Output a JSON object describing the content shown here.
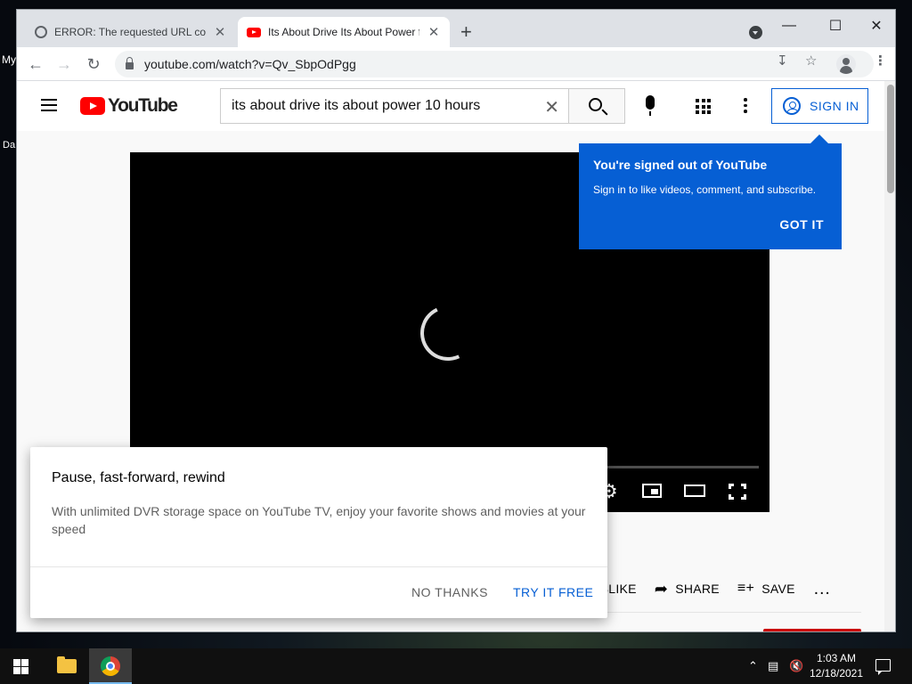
{
  "desktop": {
    "label1": "My",
    "label2": "Da"
  },
  "browser": {
    "tabs": [
      {
        "title": "ERROR: The requested URL could",
        "favicon": "globe-icon",
        "active": false
      },
      {
        "title": "Its About Drive Its About Power f",
        "favicon": "youtube-favicon",
        "active": true
      }
    ],
    "url": "youtube.com/watch?v=Qv_SbpOdPgg"
  },
  "youtube": {
    "logo_text": "YouTube",
    "search_value": "its about drive its about power 10 hours",
    "sign_in_label": "SIGN IN",
    "tooltip": {
      "title": "You're signed out of YouTube",
      "body": "Sign in to like videos, comment, and subscribe.",
      "button": "GOT IT"
    },
    "actions": {
      "dislike": "DISLIKE",
      "share": "SHARE",
      "save": "SAVE"
    },
    "promo": {
      "title": "Pause, fast-forward, rewind",
      "body": "With unlimited DVR storage space on YouTube TV, enjoy your favorite shows and movies at your speed",
      "no_thanks": "NO THANKS",
      "try_free": "TRY IT FREE"
    }
  },
  "taskbar": {
    "time": "1:03 AM",
    "date": "12/18/2021"
  },
  "colors": {
    "accent": "#065fd4",
    "youtube_red": "#ff0000"
  }
}
